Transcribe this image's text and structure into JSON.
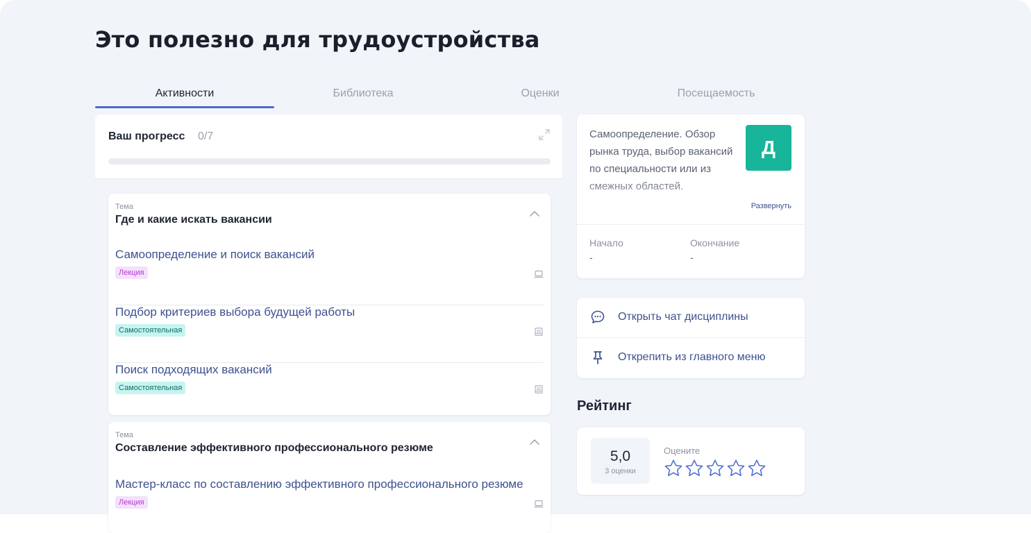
{
  "page": {
    "title": "Это полезно для трудоустройства"
  },
  "tabs": [
    {
      "label": "Активности",
      "active": true
    },
    {
      "label": "Библиотека",
      "active": false
    },
    {
      "label": "Оценки",
      "active": false
    },
    {
      "label": "Посещаемость",
      "active": false
    }
  ],
  "progress": {
    "label": "Ваш прогресс",
    "count": "0/7",
    "fraction": 0
  },
  "themes": [
    {
      "small_label": "Тема",
      "title": "Где и какие искать вакансии",
      "items": [
        {
          "title": "Самоопределение и поиск вакансий",
          "badge": "Лекция",
          "kind": "lecture",
          "icon": "laptop-icon"
        },
        {
          "title": "Подбор критериев выбора будущей работы",
          "badge": "Самостоятельная",
          "kind": "self",
          "icon": "book-icon"
        },
        {
          "title": "Поиск подходящих вакансий",
          "badge": "Самостоятельная",
          "kind": "self",
          "icon": "book-icon"
        }
      ]
    },
    {
      "small_label": "Тема",
      "title": "Составление эффективного профессионального резюме",
      "items": [
        {
          "title": "Мастер-класс по составлению эффективного профессионального резюме",
          "badge": "Лекция",
          "kind": "lecture",
          "icon": "laptop-icon"
        }
      ]
    }
  ],
  "info": {
    "description": "Самоопределение. Обзор рынка труда, выбор вакансий по специальности или из смежных областей.",
    "avatar_letter": "Д",
    "expand_label": "Развернуть",
    "start_label": "Начало",
    "start_value": "-",
    "end_label": "Окончание",
    "end_value": "-"
  },
  "actions": {
    "chat_label": "Открыть чат дисциплины",
    "unpin_label": "Открепить из главного меню"
  },
  "rating": {
    "title": "Рейтинг",
    "score": "5,0",
    "count": "3 оценки",
    "rate_label": "Оцените",
    "stars_filled": 0,
    "stars_total": 5
  },
  "colors": {
    "accent": "#4a6ad1",
    "link": "#3d5190",
    "avatar": "#19b59a",
    "lecture_badge": "#f4e1fb",
    "self_badge": "#c6f5f1"
  }
}
